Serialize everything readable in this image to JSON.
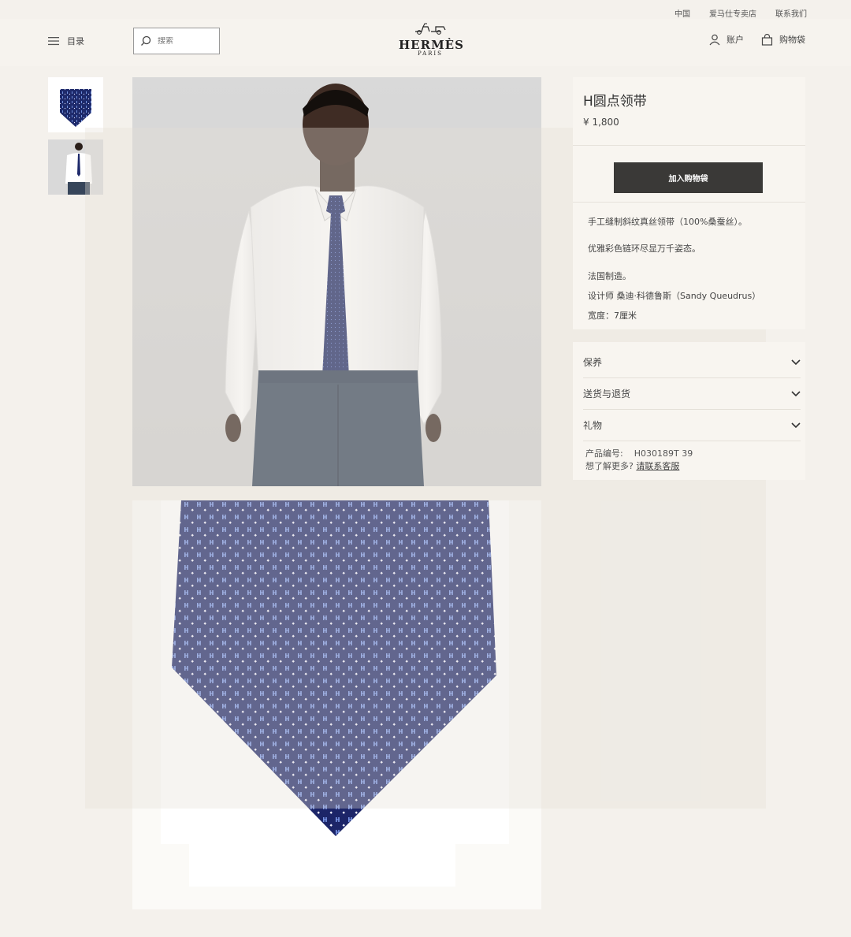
{
  "utility": {
    "country": "中国",
    "stores": "爱马仕专卖店",
    "contact": "联系我们"
  },
  "header": {
    "menu_label": "目录",
    "search_placeholder": "搜索",
    "brand": "HERMÈS",
    "brand_city": "PARIS",
    "account_label": "账户",
    "bag_label": "购物袋"
  },
  "product": {
    "title": "H圆点领带",
    "price": "¥ 1,800",
    "add_to_bag": "加入购物袋",
    "description": [
      "手工缝制斜纹真丝领带（100%桑蚕丝）。",
      "优雅彩色链环尽显万千姿态。",
      "法国制造。",
      "设计师 桑迪·科德鲁斯（Sandy Queudrus）",
      "宽度：7厘米"
    ]
  },
  "accordion": [
    {
      "label": "保养"
    },
    {
      "label": "送货与退货"
    },
    {
      "label": "礼物"
    }
  ],
  "meta": {
    "sku_label": "产品编号:",
    "sku_value": "H030189T 39",
    "help_text": "想了解更多?",
    "help_link": "请联系客服"
  },
  "colors": {
    "tie_navy": "#1e2a6b",
    "button_dark": "#3a3937",
    "background": "#f4f1ec"
  },
  "icons": [
    "hamburger-icon",
    "search-icon",
    "account-icon",
    "bag-icon",
    "chevron-down-icon"
  ]
}
